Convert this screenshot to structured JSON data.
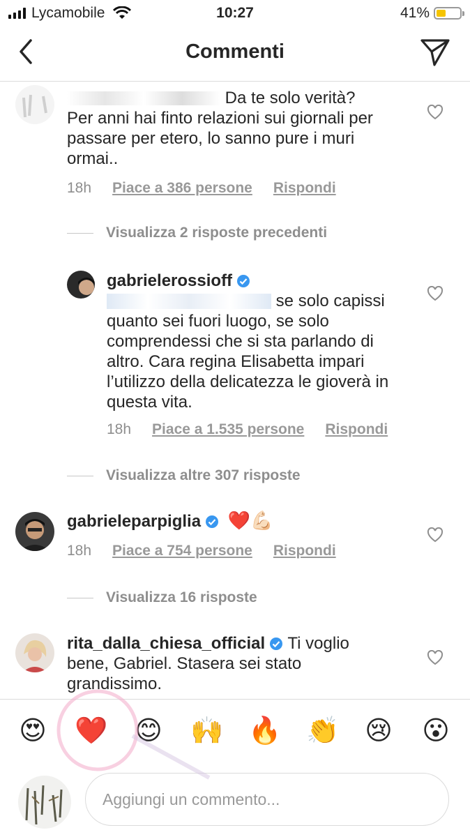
{
  "status_bar": {
    "carrier": "Lycamobile",
    "time": "10:27",
    "battery": "41%",
    "battery_level": 0.41
  },
  "header": {
    "title": "Commenti",
    "back_icon": "chevron-left-icon",
    "send_icon": "paper-plane-icon"
  },
  "comments": [
    {
      "text": "Da te solo verità? Per anni hai finto relazioni sui giornali per passare per etero, lo sanno pure i muri ormai..",
      "time": "18h",
      "likes": "Piace a 386 persone",
      "reply": "Rispondi"
    },
    {
      "view_previous": "Visualizza 2 risposte precedenti"
    },
    {
      "username": "gabrielerossioff",
      "text": "se solo capissi quanto sei fuori luogo, se solo comprendessi che si sta parlando di altro. Cara regina Elisabetta impari l’utilizzo della delicatezza le gioverà in questa vita.",
      "time": "18h",
      "likes": "Piace a 1.535 persone",
      "reply": "Rispondi"
    },
    {
      "view_more": "Visualizza altre 307 risposte"
    },
    {
      "username": "gabrieleparpiglia",
      "text": "❤️💪🏻",
      "time": "18h",
      "likes": "Piace a 754 persone",
      "reply": "Rispondi"
    },
    {
      "view_replies": "Visualizza 16 risposte"
    },
    {
      "username": "rita_dalla_chiesa_official",
      "text": "Ti voglio bene, Gabriel. Stasera sei stato grandissimo."
    }
  ],
  "emoji_bar": [
    "😍",
    "❤️",
    "😊",
    "🙌",
    "🔥",
    "👏",
    "😢",
    "😮"
  ],
  "composer": {
    "placeholder": "Aggiungi un commento..."
  },
  "colors": {
    "verified": "#3897f0",
    "battery_fill": "#f5c400",
    "secondary_text": "#8e8e8e"
  }
}
